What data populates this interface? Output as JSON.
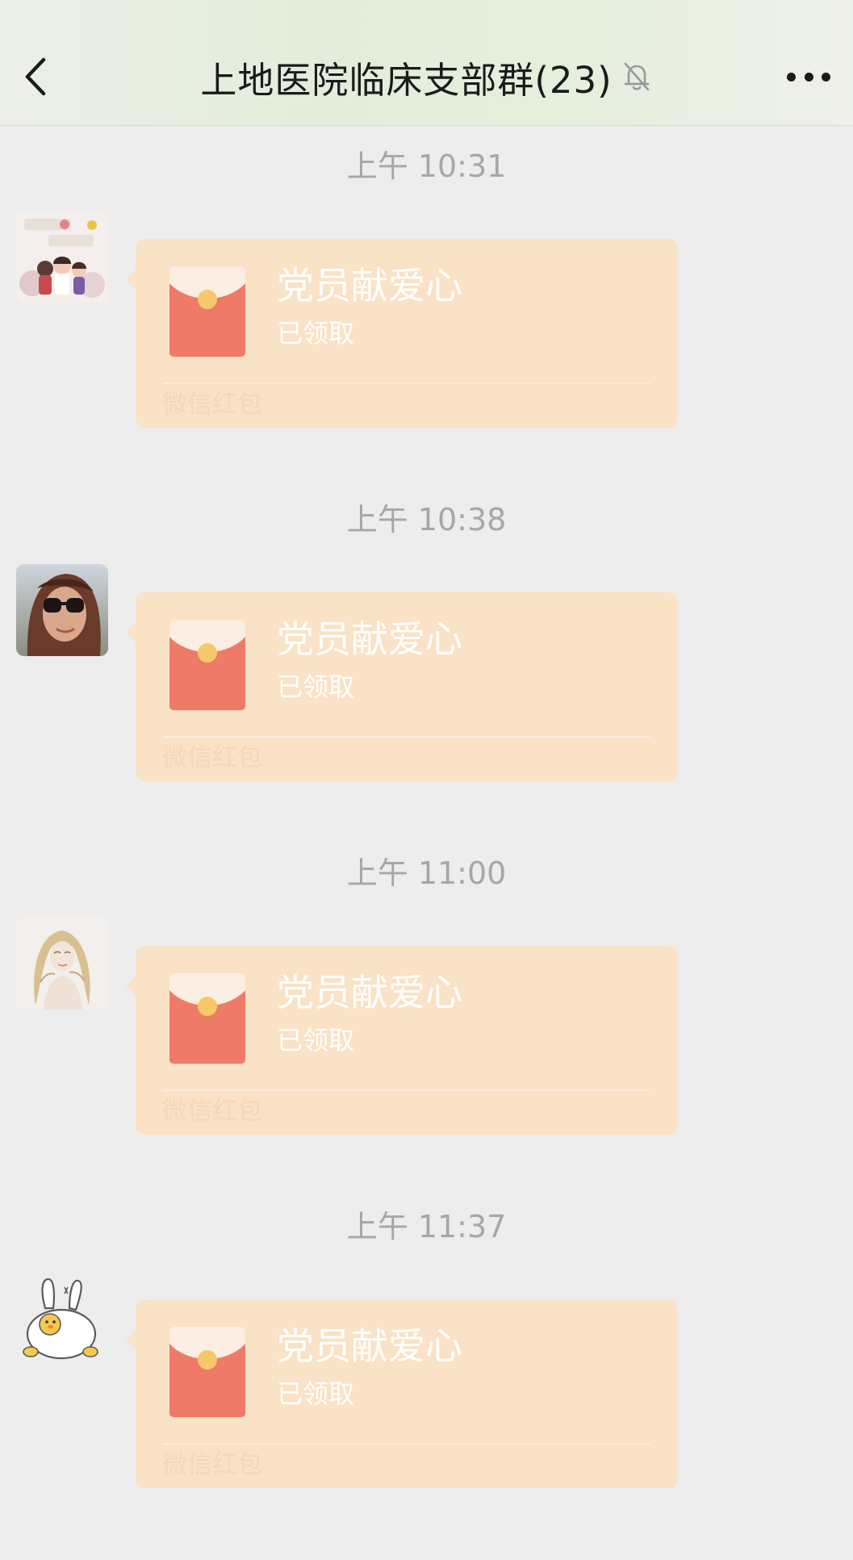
{
  "header": {
    "title": "上地医院临床支部群(23)",
    "back_icon": "chevron-left-icon",
    "mute_icon": "bell-off-icon",
    "more_icon": "more-dots-icon"
  },
  "messages": [
    {
      "time": "上午 10:31",
      "avatar": "cartoon-family-avatar",
      "packet": {
        "title": "党员献爱心",
        "status": "已领取",
        "label": "微信红包"
      }
    },
    {
      "time": "上午 10:38",
      "avatar": "sunglasses-woman-avatar",
      "packet": {
        "title": "党员献爱心",
        "status": "已领取",
        "label": "微信红包"
      }
    },
    {
      "time": "上午 11:00",
      "avatar": "sketch-woman-avatar",
      "packet": {
        "title": "党员献爱心",
        "status": "已领取",
        "label": "微信红包"
      }
    },
    {
      "time": "上午 11:37",
      "avatar": "bunny-duck-avatar",
      "packet": {
        "title": "党员献爱心",
        "status": "已领取",
        "label": "微信红包"
      }
    }
  ],
  "colors": {
    "background": "#ededed",
    "packet": "#fae2c6",
    "envelope": "#ef7a67",
    "time_text": "#a7a7a7"
  }
}
